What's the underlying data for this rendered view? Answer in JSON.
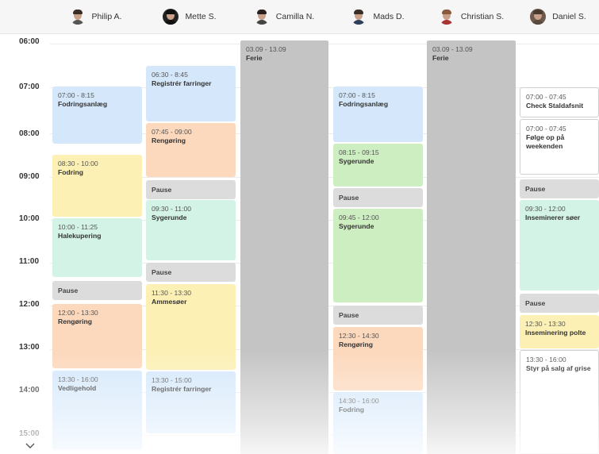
{
  "people": [
    {
      "name": "Philip A.",
      "avatar": "person-avatar"
    },
    {
      "name": "Mette S.",
      "avatar": "person-avatar"
    },
    {
      "name": "Camilla N.",
      "avatar": "person-avatar"
    },
    {
      "name": "Mads D.",
      "avatar": "person-avatar"
    },
    {
      "name": "Christian S.",
      "avatar": "person-avatar"
    },
    {
      "name": "Daniel S.",
      "avatar": "person-avatar"
    }
  ],
  "times": [
    "06:00",
    "07:00",
    "08:00",
    "09:00",
    "10:00",
    "11:00",
    "12:00",
    "13:00",
    "14:00",
    "15:00"
  ],
  "colors": {
    "blue": "#d5e8fb",
    "orange": "#fcd8bc",
    "yellow": "#fcf0b5",
    "green": "#cdeec0",
    "mint": "#d2f3e6",
    "pause": "#dcdcdc",
    "ferie": "#c4c4c4"
  },
  "events": {
    "philip": [
      {
        "time": "07:00 - 8:15",
        "name": "Fodringsanlæg"
      },
      {
        "time": "08:30 - 10:00",
        "name": "Fodring"
      },
      {
        "time": "10:00 - 11:25",
        "name": "Halekupering"
      },
      {
        "time": "",
        "name": "Pause"
      },
      {
        "time": "12:00 - 13:30",
        "name": "Rengøring"
      },
      {
        "time": "13:30 - 16:00",
        "name": "Vedligehold"
      }
    ],
    "mette": [
      {
        "time": "06:30 - 8:45",
        "name": "Registrér farringer"
      },
      {
        "time": "07:45 - 09:00",
        "name": "Rengøring"
      },
      {
        "time": "",
        "name": "Pause"
      },
      {
        "time": "09:30 - 11:00",
        "name": "Sygerunde"
      },
      {
        "time": "",
        "name": "Pause"
      },
      {
        "time": "11:30 - 13:30",
        "name": "Ammesøer"
      },
      {
        "time": "13:30 - 15:00",
        "name": "Registrér farringer"
      }
    ],
    "camilla": [
      {
        "time": "03.09 - 13.09",
        "name": "Ferie"
      }
    ],
    "mads": [
      {
        "time": "07:00 - 8:15",
        "name": "Fodringsanlæg"
      },
      {
        "time": "08:15 - 09:15",
        "name": "Sygerunde"
      },
      {
        "time": "",
        "name": "Pause"
      },
      {
        "time": "09:45 - 12:00",
        "name": "Sygerunde"
      },
      {
        "time": "",
        "name": "Pause"
      },
      {
        "time": "12:30 - 14:30",
        "name": "Rengøring"
      },
      {
        "time": "14:30 - 16:00",
        "name": "Fodring"
      }
    ],
    "christian": [
      {
        "time": "03.09 - 13.09",
        "name": "Ferie"
      }
    ],
    "daniel": [
      {
        "time": "07:00 - 07:45",
        "name": "Check Staldafsnit"
      },
      {
        "time": "07:00 - 07:45",
        "name": "Følge op på weekenden"
      },
      {
        "time": "",
        "name": "Pause"
      },
      {
        "time": "09:30 - 12:00",
        "name": "Inseminerer søer"
      },
      {
        "time": "",
        "name": "Pause"
      },
      {
        "time": "12:30 - 13:30",
        "name": "Inseminering polte"
      },
      {
        "time": "13:30 - 16:00",
        "name": "Styr på salg af grise"
      }
    ]
  }
}
